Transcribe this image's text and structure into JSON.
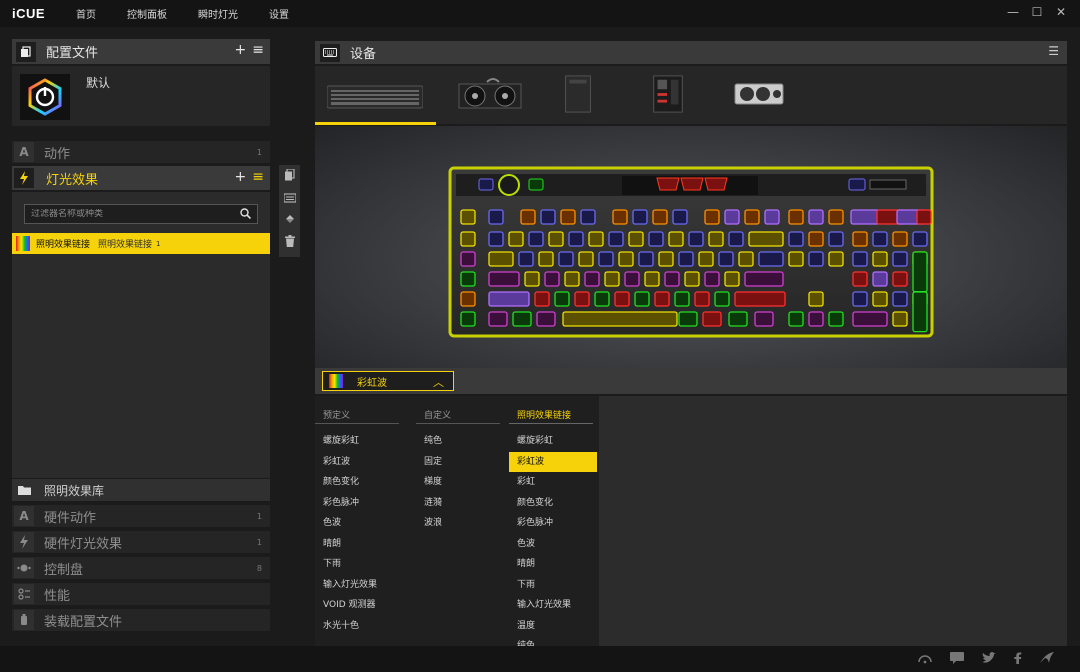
{
  "app": {
    "logo": "iCUE"
  },
  "nav": [
    "首页",
    "控制面板",
    "瞬时灯光",
    "设置"
  ],
  "window_controls": {
    "minimize": "—",
    "maximize": "☐",
    "close": "✕"
  },
  "profiles": {
    "title": "配置文件",
    "add": "+",
    "menu": "≡",
    "current": "默认"
  },
  "sections": {
    "actions": {
      "label": "动作",
      "count": "1"
    },
    "lighting": {
      "label": "灯光效果",
      "add": "+",
      "menu": "≡"
    },
    "library": {
      "label": "照明效果库"
    },
    "hw_actions": {
      "label": "硬件动作",
      "count": "1"
    },
    "hw_lighting": {
      "label": "硬件灯光效果",
      "count": "1"
    },
    "dial": {
      "label": "控制盘",
      "count": "8"
    },
    "performance": {
      "label": "性能"
    },
    "load_profile": {
      "label": "装载配置文件"
    }
  },
  "lighting_filter": {
    "placeholder": "过滤器名称或种类"
  },
  "lighting_item": {
    "name": "照明效果链接",
    "type": "照明效果链接",
    "count": "1"
  },
  "devices": {
    "title": "设备",
    "thumbs": [
      "keyboard",
      "aio-cooler",
      "case",
      "motherboard",
      "gpu"
    ]
  },
  "effect_select": {
    "label": "彩虹波",
    "chevron": "︿"
  },
  "effect_columns": [
    {
      "header": "预定义",
      "active": false,
      "items": [
        "螺旋彩虹",
        "彩虹波",
        "颜色变化",
        "彩色脉冲",
        "色波",
        "晴朗",
        "下雨",
        "输入灯光效果",
        "VOID 观测器",
        "水光十色"
      ]
    },
    {
      "header": "自定义",
      "active": false,
      "items": [
        "纯色",
        "固定",
        "梯度",
        "涟漪",
        "波浪"
      ]
    },
    {
      "header": "照明效果链接",
      "active": true,
      "items": [
        "螺旋彩虹",
        "彩虹波",
        "彩虹",
        "颜色变化",
        "彩色脉冲",
        "色波",
        "晴朗",
        "下雨",
        "输入灯光效果",
        "温度",
        "纯色"
      ]
    }
  ],
  "selected_effect_index": 1,
  "colors": {
    "accent": "#f5d20a",
    "panel": "#3a3a3a",
    "bg": "#1b1b1b"
  }
}
